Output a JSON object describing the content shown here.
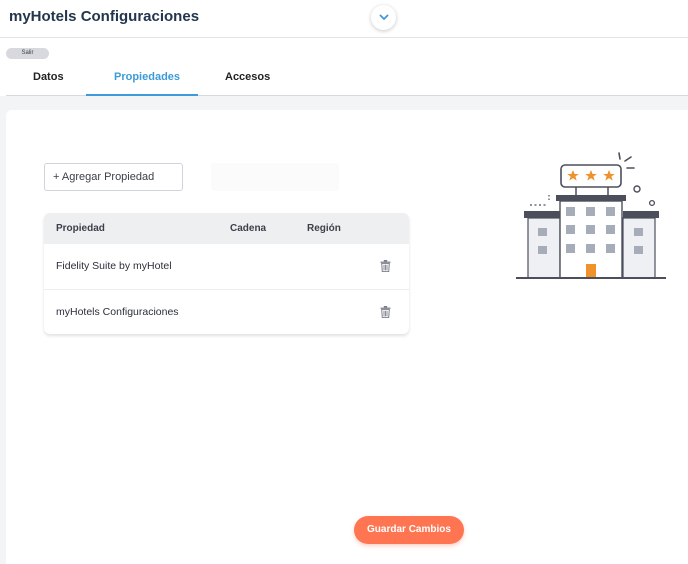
{
  "header": {
    "title": "myHotels Configuraciones",
    "collapse_icon": "chevron-down-icon"
  },
  "tabs": {
    "exit_label": "Salir",
    "items": [
      {
        "label": "Datos",
        "active": false
      },
      {
        "label": "Propiedades",
        "active": true
      },
      {
        "label": "Accesos",
        "active": false
      }
    ]
  },
  "main": {
    "add_property_label": "+ Agregar Propiedad",
    "table": {
      "headers": [
        "Propiedad",
        "Cadena",
        "Región"
      ],
      "rows": [
        {
          "property": "Fidelity Suite by myHotel",
          "chain": "",
          "region": "",
          "action_icon": "trash-icon"
        },
        {
          "property": "myHotels Configuraciones",
          "chain": "",
          "region": "",
          "action_icon": "trash-icon"
        }
      ]
    },
    "illustration": "hotel-three-stars-icon"
  },
  "footer": {
    "save_label": "Guardar Cambios"
  },
  "colors": {
    "accent": "#3c9bd8",
    "save_button": "#ff7552",
    "star": "#f0922b",
    "title": "#23364d"
  }
}
